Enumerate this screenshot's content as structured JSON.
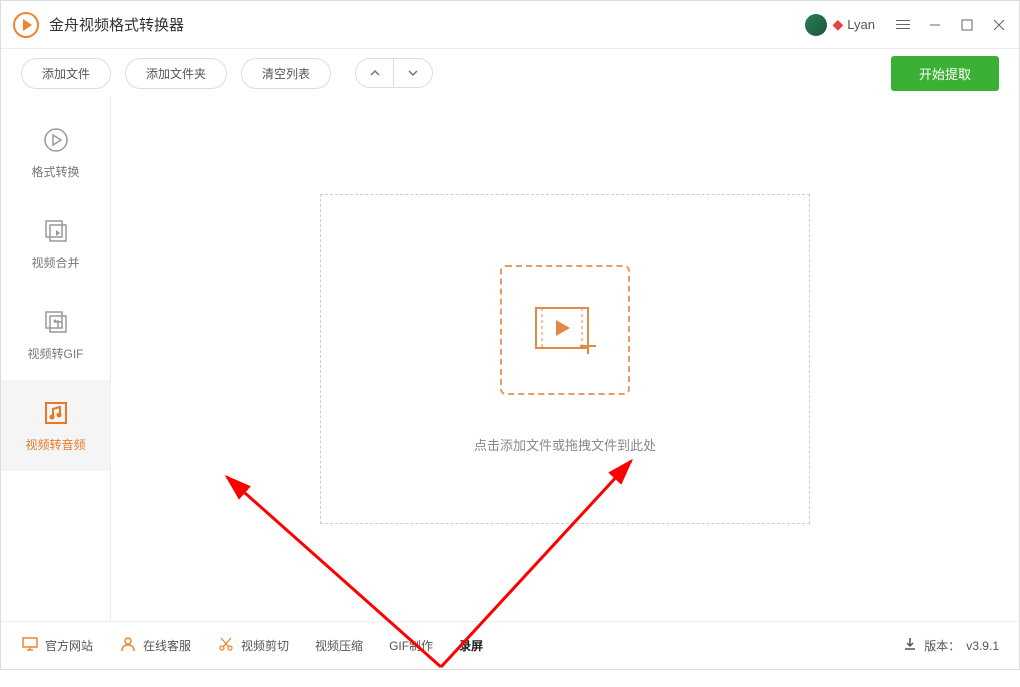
{
  "app": {
    "title": "金舟视频格式转换器"
  },
  "user": {
    "name": "Lyan"
  },
  "toolbar": {
    "add_file": "添加文件",
    "add_folder": "添加文件夹",
    "clear_list": "清空列表",
    "start": "开始提取"
  },
  "sidebar": {
    "format_convert": "格式转换",
    "video_merge": "视频合并",
    "video_to_gif": "视频转GIF",
    "video_to_audio": "视频转音频"
  },
  "dropzone": {
    "text": "点击添加文件或拖拽文件到此处"
  },
  "footer": {
    "official_site": "官方网站",
    "online_support": "在线客服",
    "video_cut": "视频剪切",
    "video_compress": "视频压缩",
    "gif_make": "GIF制作",
    "screen_record": "录屏",
    "version_label": "版本：",
    "version_value": "v3.9.1"
  }
}
